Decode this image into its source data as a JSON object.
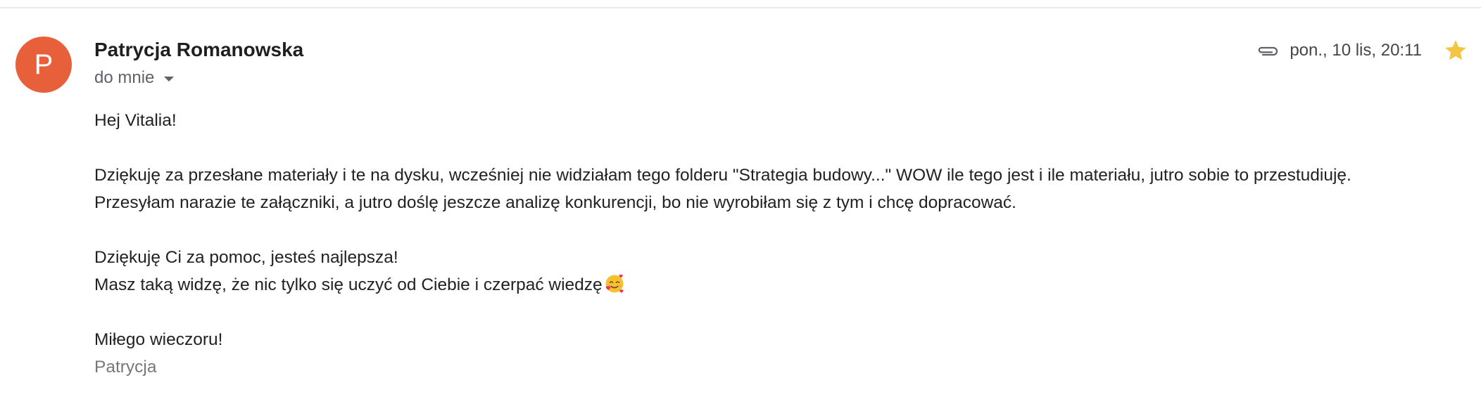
{
  "sender": {
    "avatar_initial": "P",
    "name": "Patrycja Romanowska",
    "recipients_label": "do mnie"
  },
  "meta": {
    "date": "pon., 10 lis, 20:11",
    "has_attachment": true,
    "starred": true
  },
  "message": {
    "greeting": "Hej Vitalia!",
    "paragraph1_line1": "Dziękuję za przesłane materiały i te na dysku, wcześniej nie widziałam tego folderu \"Strategia budowy...\" WOW ile tego jest i ile materiału, jutro sobie to przestudiuję.",
    "paragraph1_line2": "Przesyłam narazie te załączniki, a jutro doślę jeszcze analizę konkurencji, bo nie wyrobiłam się z tym i chcę dopracować.",
    "paragraph2_line1": "Dziękuję Ci za pomoc, jesteś najlepsza!",
    "paragraph2_line2": "Masz taką widzę, że nic tylko się uczyć od Ciebie i czerpać wiedzę",
    "closing": "Miłego wieczoru!",
    "signature": "Patrycja"
  },
  "colors": {
    "avatar_bg": "#e8603a",
    "star": "#f4c542",
    "secondary_text": "#5f6368",
    "signature_text": "#777777"
  },
  "icons": {
    "attachment": "paperclip-icon",
    "star": "star-icon",
    "expand": "chevron-down-icon",
    "emoji": "smiling-face-with-hearts-emoji"
  }
}
